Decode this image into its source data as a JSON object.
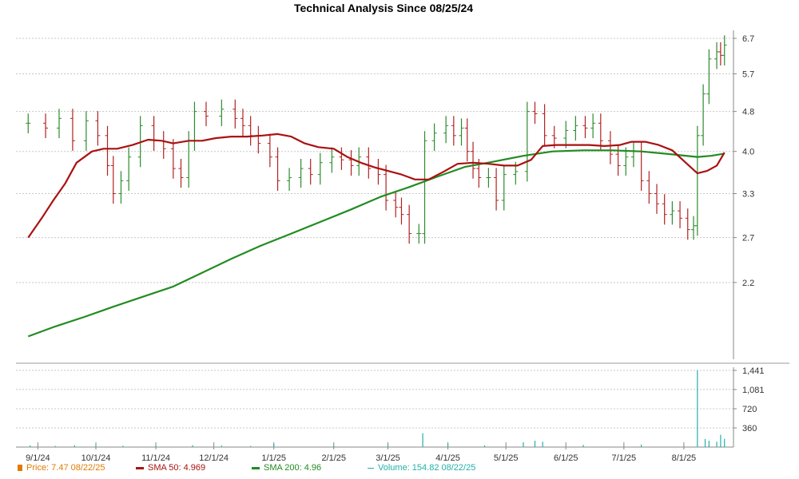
{
  "chart_data": {
    "type": "line",
    "title": "Technical Analysis Since 08/25/24",
    "price_panel": {
      "y_ticks": [
        "6.7",
        "5.7",
        "4.8",
        "4.0",
        "3.3",
        "2.7",
        "2.2"
      ],
      "y_tick_values": [
        6.7,
        5.7,
        4.8,
        4.0,
        3.3,
        2.7,
        2.2
      ],
      "ylim": [
        1.55,
        6.95
      ],
      "scale": "log"
    },
    "volume_panel": {
      "y_ticks": [
        "1,441",
        "1,081",
        "720",
        "360"
      ],
      "y_tick_values": [
        1441,
        1081,
        720,
        360
      ],
      "ylim": [
        0,
        1500
      ]
    },
    "x_range": [
      "2024-08-26",
      "2025-08-22"
    ],
    "x_ticks": [
      {
        "label": "9/1/24",
        "date": "2024-09-01"
      },
      {
        "label": "10/1/24",
        "date": "2024-10-01"
      },
      {
        "label": "11/1/24",
        "date": "2024-11-01"
      },
      {
        "label": "12/1/24",
        "date": "2024-12-01"
      },
      {
        "label": "1/1/25",
        "date": "2025-01-01"
      },
      {
        "label": "2/1/25",
        "date": "2025-02-01"
      },
      {
        "label": "3/1/25",
        "date": "2025-03-01"
      },
      {
        "label": "4/1/25",
        "date": "2025-04-01"
      },
      {
        "label": "5/1/25",
        "date": "2025-05-01"
      },
      {
        "label": "6/1/25",
        "date": "2025-06-01"
      },
      {
        "label": "7/1/25",
        "date": "2025-07-01"
      },
      {
        "label": "8/1/25",
        "date": "2025-08-01"
      }
    ],
    "series": [
      {
        "name": "Price",
        "style": "ohlc-bars",
        "color_up": "#2e8b2e",
        "color_down": "#b22222",
        "points": [
          [
            "2024-08-27",
            4.55
          ],
          [
            "2024-09-05",
            4.45
          ],
          [
            "2024-09-12",
            4.65
          ],
          [
            "2024-09-19",
            4.2
          ],
          [
            "2024-09-26",
            4.6
          ],
          [
            "2024-10-02",
            4.3
          ],
          [
            "2024-10-07",
            3.75
          ],
          [
            "2024-10-10",
            3.3
          ],
          [
            "2024-10-14",
            3.5
          ],
          [
            "2024-10-18",
            3.9
          ],
          [
            "2024-10-24",
            4.5
          ],
          [
            "2024-10-31",
            4.2
          ],
          [
            "2024-11-05",
            4.05
          ],
          [
            "2024-11-10",
            3.7
          ],
          [
            "2024-11-14",
            3.55
          ],
          [
            "2024-11-18",
            4.2
          ],
          [
            "2024-11-21",
            4.8
          ],
          [
            "2024-11-27",
            4.7
          ],
          [
            "2024-12-05",
            4.85
          ],
          [
            "2024-12-12",
            4.65
          ],
          [
            "2024-12-16",
            4.5
          ],
          [
            "2024-12-20",
            4.3
          ],
          [
            "2024-12-24",
            4.15
          ],
          [
            "2024-12-30",
            3.9
          ],
          [
            "2025-01-03",
            3.5
          ],
          [
            "2025-01-09",
            3.55
          ],
          [
            "2025-01-15",
            3.7
          ],
          [
            "2025-01-20",
            3.6
          ],
          [
            "2025-01-25",
            3.8
          ],
          [
            "2025-01-31",
            3.9
          ],
          [
            "2025-02-05",
            3.85
          ],
          [
            "2025-02-10",
            3.75
          ],
          [
            "2025-02-14",
            3.9
          ],
          [
            "2025-02-19",
            3.7
          ],
          [
            "2025-02-24",
            3.6
          ],
          [
            "2025-02-28",
            3.2
          ],
          [
            "2025-03-05",
            3.1
          ],
          [
            "2025-03-08",
            3.0
          ],
          [
            "2025-03-12",
            2.75
          ],
          [
            "2025-03-17",
            2.75
          ],
          [
            "2025-03-20",
            4.2
          ],
          [
            "2025-03-25",
            4.35
          ],
          [
            "2025-03-31",
            4.5
          ],
          [
            "2025-04-04",
            4.3
          ],
          [
            "2025-04-08",
            4.45
          ],
          [
            "2025-04-11",
            4.0
          ],
          [
            "2025-04-14",
            3.7
          ],
          [
            "2025-04-17",
            3.55
          ],
          [
            "2025-04-22",
            3.55
          ],
          [
            "2025-04-26",
            3.2
          ],
          [
            "2025-04-30",
            3.6
          ],
          [
            "2025-05-06",
            3.65
          ],
          [
            "2025-05-12",
            4.8
          ],
          [
            "2025-05-16",
            4.75
          ],
          [
            "2025-05-21",
            4.3
          ],
          [
            "2025-05-26",
            4.25
          ],
          [
            "2025-06-01",
            4.4
          ],
          [
            "2025-06-06",
            4.5
          ],
          [
            "2025-06-11",
            4.45
          ],
          [
            "2025-06-15",
            4.55
          ],
          [
            "2025-06-19",
            4.2
          ],
          [
            "2025-06-24",
            3.95
          ],
          [
            "2025-06-28",
            3.75
          ],
          [
            "2025-07-02",
            3.9
          ],
          [
            "2025-07-06",
            4.0
          ],
          [
            "2025-07-10",
            3.5
          ],
          [
            "2025-07-14",
            3.3
          ],
          [
            "2025-07-18",
            3.15
          ],
          [
            "2025-07-22",
            3.0
          ],
          [
            "2025-07-26",
            3.05
          ],
          [
            "2025-07-30",
            2.95
          ],
          [
            "2025-08-03",
            2.8
          ],
          [
            "2025-08-06",
            2.85
          ],
          [
            "2025-08-08",
            4.3
          ],
          [
            "2025-08-11",
            5.2
          ],
          [
            "2025-08-14",
            6.1
          ],
          [
            "2025-08-18",
            6.3
          ],
          [
            "2025-08-20",
            6.2
          ],
          [
            "2025-08-22",
            6.5
          ]
        ]
      },
      {
        "name": "SMA 50",
        "color": "#aa1111",
        "points": [
          [
            "2024-08-27",
            2.7
          ],
          [
            "2024-09-03",
            2.95
          ],
          [
            "2024-09-09",
            3.2
          ],
          [
            "2024-09-15",
            3.45
          ],
          [
            "2024-09-21",
            3.8
          ],
          [
            "2024-09-29",
            4.0
          ],
          [
            "2024-10-05",
            4.05
          ],
          [
            "2024-10-12",
            4.05
          ],
          [
            "2024-10-20",
            4.12
          ],
          [
            "2024-10-28",
            4.22
          ],
          [
            "2024-11-04",
            4.2
          ],
          [
            "2024-11-10",
            4.15
          ],
          [
            "2024-11-18",
            4.2
          ],
          [
            "2024-11-25",
            4.2
          ],
          [
            "2024-12-02",
            4.25
          ],
          [
            "2024-12-10",
            4.28
          ],
          [
            "2024-12-18",
            4.28
          ],
          [
            "2024-12-26",
            4.3
          ],
          [
            "2025-01-03",
            4.33
          ],
          [
            "2025-01-10",
            4.28
          ],
          [
            "2025-01-17",
            4.15
          ],
          [
            "2025-01-24",
            4.08
          ],
          [
            "2025-02-01",
            4.05
          ],
          [
            "2025-02-08",
            3.9
          ],
          [
            "2025-02-15",
            3.8
          ],
          [
            "2025-02-22",
            3.72
          ],
          [
            "2025-03-01",
            3.66
          ],
          [
            "2025-03-08",
            3.6
          ],
          [
            "2025-03-15",
            3.52
          ],
          [
            "2025-03-22",
            3.52
          ],
          [
            "2025-03-30",
            3.65
          ],
          [
            "2025-04-06",
            3.78
          ],
          [
            "2025-04-14",
            3.8
          ],
          [
            "2025-04-22",
            3.78
          ],
          [
            "2025-04-30",
            3.75
          ],
          [
            "2025-05-07",
            3.75
          ],
          [
            "2025-05-14",
            3.85
          ],
          [
            "2025-05-20",
            4.1
          ],
          [
            "2025-05-27",
            4.12
          ],
          [
            "2025-06-05",
            4.12
          ],
          [
            "2025-06-13",
            4.12
          ],
          [
            "2025-06-21",
            4.1
          ],
          [
            "2025-06-29",
            4.12
          ],
          [
            "2025-07-05",
            4.18
          ],
          [
            "2025-07-12",
            4.18
          ],
          [
            "2025-07-19",
            4.12
          ],
          [
            "2025-07-26",
            4.02
          ],
          [
            "2025-08-02",
            3.8
          ],
          [
            "2025-08-08",
            3.62
          ],
          [
            "2025-08-13",
            3.66
          ],
          [
            "2025-08-18",
            3.75
          ],
          [
            "2025-08-22",
            3.98
          ]
        ]
      },
      {
        "name": "SMA 200",
        "color": "#228b22",
        "points": [
          [
            "2024-08-27",
            1.72
          ],
          [
            "2024-09-10",
            1.8
          ],
          [
            "2024-09-25",
            1.88
          ],
          [
            "2024-10-10",
            1.97
          ],
          [
            "2024-10-25",
            2.06
          ],
          [
            "2024-11-10",
            2.16
          ],
          [
            "2024-11-25",
            2.3
          ],
          [
            "2024-12-10",
            2.45
          ],
          [
            "2024-12-25",
            2.6
          ],
          [
            "2025-01-10",
            2.75
          ],
          [
            "2025-01-25",
            2.9
          ],
          [
            "2025-02-10",
            3.07
          ],
          [
            "2025-02-25",
            3.25
          ],
          [
            "2025-03-12",
            3.4
          ],
          [
            "2025-03-27",
            3.57
          ],
          [
            "2025-04-10",
            3.73
          ],
          [
            "2025-04-25",
            3.82
          ],
          [
            "2025-05-10",
            3.92
          ],
          [
            "2025-05-25",
            4.0
          ],
          [
            "2025-06-10",
            4.02
          ],
          [
            "2025-06-25",
            4.02
          ],
          [
            "2025-07-10",
            4.0
          ],
          [
            "2025-07-25",
            3.95
          ],
          [
            "2025-08-08",
            3.9
          ],
          [
            "2025-08-15",
            3.92
          ],
          [
            "2025-08-22",
            3.96
          ]
        ]
      },
      {
        "name": "Volume",
        "style": "bars",
        "color": "#20b2aa",
        "points": [
          [
            "2024-08-28",
            30
          ],
          [
            "2024-09-10",
            20
          ],
          [
            "2024-09-20",
            35
          ],
          [
            "2024-10-01",
            40
          ],
          [
            "2024-10-15",
            25
          ],
          [
            "2024-11-01",
            30
          ],
          [
            "2024-11-20",
            35
          ],
          [
            "2024-12-05",
            28
          ],
          [
            "2024-12-20",
            20
          ],
          [
            "2025-01-01",
            60
          ],
          [
            "2025-02-01",
            25
          ],
          [
            "2025-03-01",
            40
          ],
          [
            "2025-03-19",
            260
          ],
          [
            "2025-04-01",
            70
          ],
          [
            "2025-04-20",
            30
          ],
          [
            "2025-05-10",
            90
          ],
          [
            "2025-05-16",
            120
          ],
          [
            "2025-05-20",
            100
          ],
          [
            "2025-06-10",
            40
          ],
          [
            "2025-07-10",
            45
          ],
          [
            "2025-08-08",
            1441
          ],
          [
            "2025-08-12",
            150
          ],
          [
            "2025-08-14",
            120
          ],
          [
            "2025-08-18",
            100
          ],
          [
            "2025-08-20",
            230
          ],
          [
            "2025-08-22",
            155
          ]
        ]
      }
    ],
    "legend": [
      {
        "label": "Price: 7.47  08/22/25",
        "color": "#e07b00",
        "marker": "square"
      },
      {
        "label": "SMA 50: 4.969",
        "color": "#aa1111",
        "marker": "line"
      },
      {
        "label": "SMA 200: 4.96",
        "color": "#228b22",
        "marker": "line"
      },
      {
        "label": "Volume: 154.82  08/22/25",
        "color": "#20b2aa",
        "marker": "thin-line"
      }
    ]
  }
}
